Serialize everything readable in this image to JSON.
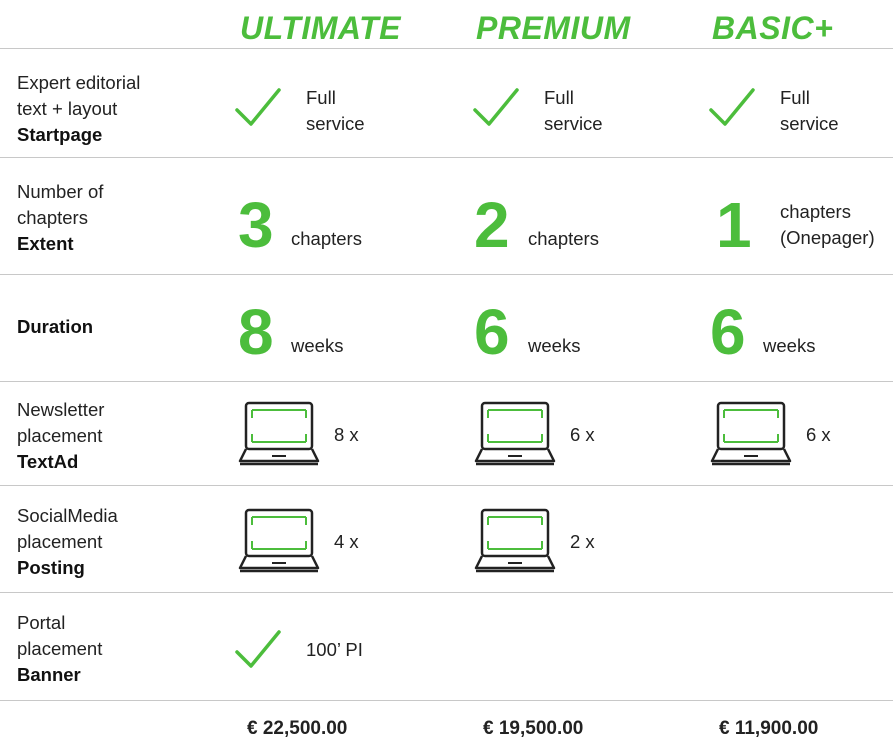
{
  "colors": {
    "accent": "#4cbd3c",
    "text": "#222222",
    "divider": "#c8c8c8"
  },
  "plans": [
    "ULTIMATE",
    "PREMIUM",
    "BASIC+"
  ],
  "rows": {
    "startpage": {
      "label_lines": [
        "Expert editorial",
        "text + layout"
      ],
      "label_bold": "Startpage",
      "cells": [
        {
          "icon": "check-icon",
          "text_lines": [
            "Full",
            "service"
          ]
        },
        {
          "icon": "check-icon",
          "text_lines": [
            "Full",
            "service"
          ]
        },
        {
          "icon": "check-icon",
          "text_lines": [
            "Full",
            "service"
          ]
        }
      ]
    },
    "extent": {
      "label_lines": [
        "Number of",
        "chapters"
      ],
      "label_bold": "Extent",
      "cells": [
        {
          "number": "3",
          "text_lines": [
            "chapters"
          ]
        },
        {
          "number": "2",
          "text_lines": [
            "chapters"
          ]
        },
        {
          "number": "1",
          "text_lines": [
            "chapters",
            "(Onepager)"
          ]
        }
      ]
    },
    "duration": {
      "label_bold": "Duration",
      "cells": [
        {
          "number": "8",
          "text": "weeks"
        },
        {
          "number": "6",
          "text": "weeks"
        },
        {
          "number": "6",
          "text": "weeks"
        }
      ]
    },
    "textad": {
      "label_lines": [
        "Newsletter",
        "placement"
      ],
      "label_bold": "TextAd",
      "cells": [
        {
          "icon": "laptop-icon",
          "text": "8 x"
        },
        {
          "icon": "laptop-icon",
          "text": "6 x"
        },
        {
          "icon": "laptop-icon",
          "text": "6 x"
        }
      ]
    },
    "posting": {
      "label_lines": [
        "SocialMedia",
        "placement"
      ],
      "label_bold": "Posting",
      "cells": [
        {
          "icon": "laptop-icon",
          "text": "4 x"
        },
        {
          "icon": "laptop-icon",
          "text": "2 x"
        }
      ]
    },
    "banner": {
      "label_lines": [
        "Portal",
        "placement"
      ],
      "label_bold": "Banner",
      "cells": [
        {
          "icon": "check-icon",
          "text": "100’ PI"
        }
      ]
    }
  },
  "prices": [
    "€ 22,500.00",
    "€ 19,500.00",
    "€ 11,900.00"
  ]
}
